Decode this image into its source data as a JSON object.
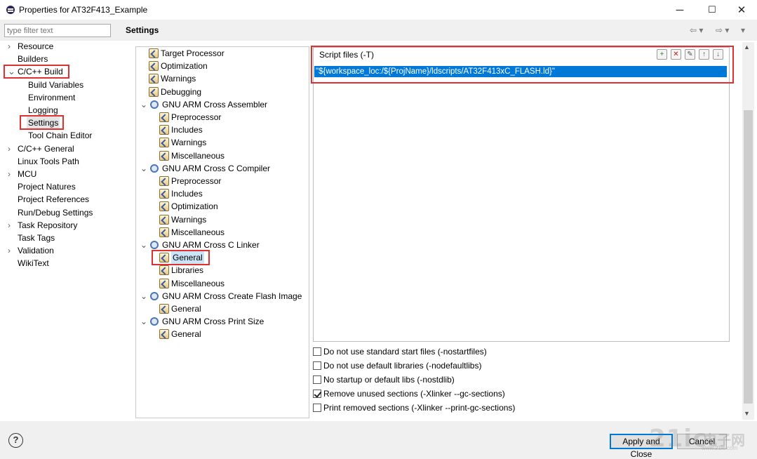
{
  "window": {
    "title": "Properties for AT32F413_Example",
    "minimize": "─",
    "maximize": "☐",
    "close": "✕"
  },
  "filter": {
    "placeholder": "type filter text"
  },
  "left_nav": [
    {
      "label": "Resource",
      "expandable": true
    },
    {
      "label": "Builders"
    },
    {
      "label": "C/C++ Build",
      "expanded": true
    },
    {
      "label": "Build Variables"
    },
    {
      "label": "Environment"
    },
    {
      "label": "Logging"
    },
    {
      "label": "Settings",
      "selected": true
    },
    {
      "label": "Tool Chain Editor"
    },
    {
      "label": "C/C++ General",
      "expandable": true
    },
    {
      "label": "Linux Tools Path"
    },
    {
      "label": "MCU",
      "expandable": true
    },
    {
      "label": "Project Natures"
    },
    {
      "label": "Project References"
    },
    {
      "label": "Run/Debug Settings"
    },
    {
      "label": "Task Repository",
      "expandable": true
    },
    {
      "label": "Task Tags"
    },
    {
      "label": "Validation",
      "expandable": true
    },
    {
      "label": "WikiText"
    }
  ],
  "page": {
    "title": "Settings",
    "back_icon": "⇦ ▾",
    "forward_icon": "⇨ ▾",
    "menu_icon": "▾"
  },
  "tool_tree": [
    {
      "label": "Target Processor",
      "icon": "option"
    },
    {
      "label": "Optimization",
      "icon": "option"
    },
    {
      "label": "Warnings",
      "icon": "option"
    },
    {
      "label": "Debugging",
      "icon": "option"
    },
    {
      "label": "GNU ARM Cross Assembler",
      "icon": "tool"
    },
    {
      "label": "Preprocessor",
      "icon": "option"
    },
    {
      "label": "Includes",
      "icon": "option"
    },
    {
      "label": "Warnings",
      "icon": "option"
    },
    {
      "label": "Miscellaneous",
      "icon": "option"
    },
    {
      "label": "GNU ARM Cross C Compiler",
      "icon": "tool"
    },
    {
      "label": "Preprocessor",
      "icon": "option"
    },
    {
      "label": "Includes",
      "icon": "option"
    },
    {
      "label": "Optimization",
      "icon": "option"
    },
    {
      "label": "Warnings",
      "icon": "option"
    },
    {
      "label": "Miscellaneous",
      "icon": "option"
    },
    {
      "label": "GNU ARM Cross C Linker",
      "icon": "tool"
    },
    {
      "label": "General",
      "icon": "option",
      "selected": true
    },
    {
      "label": "Libraries",
      "icon": "option"
    },
    {
      "label": "Miscellaneous",
      "icon": "option"
    },
    {
      "label": "GNU ARM Cross Create Flash Image",
      "icon": "tool"
    },
    {
      "label": "General",
      "icon": "option"
    },
    {
      "label": "GNU ARM Cross Print Size",
      "icon": "tool"
    },
    {
      "label": "General",
      "icon": "option"
    }
  ],
  "script_files": {
    "label": "Script files (-T)",
    "entry": "\"${workspace_loc:/${ProjName}/ldscripts/AT32F413xC_FLASH.ld}\"",
    "tools": [
      "+",
      "✕",
      "✎",
      "↑",
      "↓"
    ]
  },
  "options": [
    {
      "label": "Do not use standard start files (-nostartfiles)",
      "checked": false
    },
    {
      "label": "Do not use default libraries (-nodefaultlibs)",
      "checked": false
    },
    {
      "label": "No startup or default libs (-nostdlib)",
      "checked": false
    },
    {
      "label": "Remove unused sections (-Xlinker --gc-sections)",
      "checked": true
    },
    {
      "label": "Print removed sections (-Xlinker --print-gc-sections)",
      "checked": false
    }
  ],
  "buttons": {
    "help": "?",
    "apply_close": "Apply and Close",
    "cancel": "Cancel"
  },
  "watermark": {
    "text": "21ic",
    "cn": "电子网",
    "sub": "www.21ic.com"
  },
  "colors": {
    "selection": "#0078d7",
    "highlight_box": "#e03030"
  }
}
